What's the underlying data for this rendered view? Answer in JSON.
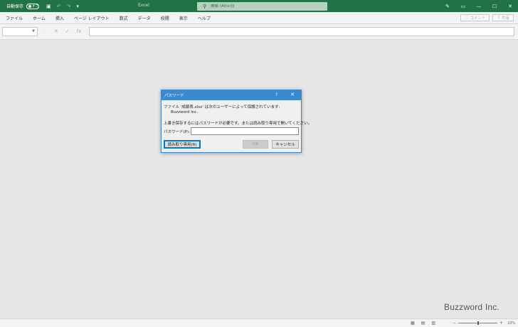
{
  "titlebar": {
    "autosave_label": "自動保存",
    "autosave_state": "オフ",
    "app_title": "Excel",
    "search_placeholder": "検索 (Alt+Q)",
    "minimize": "—",
    "maximize": "☐",
    "close": "✕"
  },
  "ribbon": {
    "tabs": [
      "ファイル",
      "ホーム",
      "挿入",
      "ページ レイアウト",
      "数式",
      "データ",
      "校閲",
      "表示",
      "ヘルプ"
    ],
    "comment_label": "コメント",
    "share_label": "共有"
  },
  "formula": {
    "fx": "fx"
  },
  "dialog": {
    "title": "パスワード",
    "help": "?",
    "close": "✕",
    "message_line1": "ファイル '成績表.xlsx' は次のユーザーによって保護されています:",
    "owner": "Buzzword Inc.",
    "message_line2": "上書き保存するにはパスワードが必要です。または読み取り専用で開いてください。",
    "password_label": "パスワード(P):",
    "password_value": "",
    "readonly_button": "読み取り専用(R)",
    "ok_button": "OK",
    "cancel_button": "キャンセル"
  },
  "status": {
    "ready": "",
    "zoom_minus": "−",
    "zoom_plus": "+",
    "zoom_percent": "10%",
    "zoom_level": 0.5
  },
  "watermark": "Buzzword Inc."
}
